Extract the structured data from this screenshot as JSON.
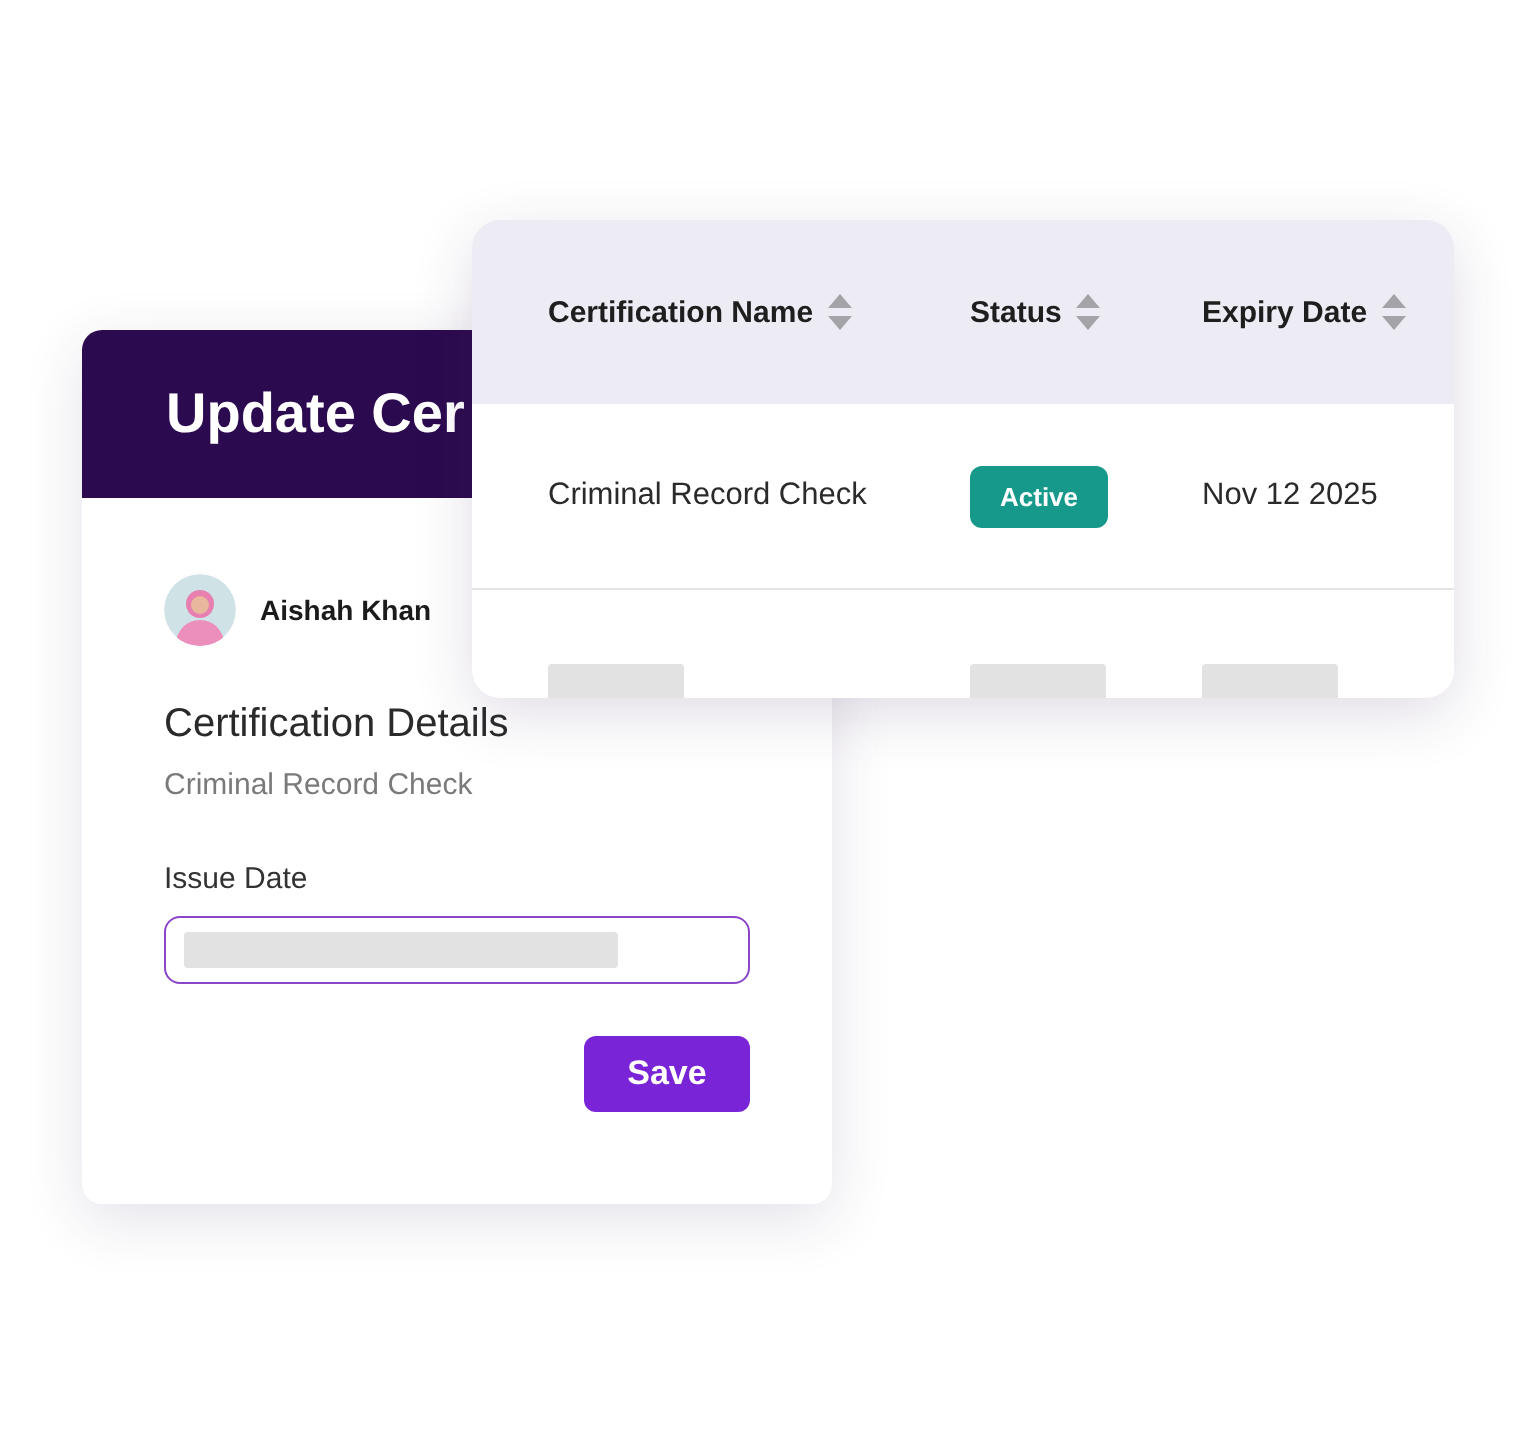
{
  "update_form": {
    "title": "Update Cer",
    "user": {
      "name": "Aishah Khan"
    },
    "section_title": "Certification Details",
    "certification": "Criminal Record Check",
    "field": {
      "label": "Issue Date"
    },
    "button": "Save"
  },
  "table": {
    "columns": [
      {
        "label": "Certification Name",
        "sortable": true
      },
      {
        "label": "Status",
        "sortable": true
      },
      {
        "label": "Expiry Date",
        "sortable": true
      }
    ],
    "rows": [
      {
        "name": "Criminal Record Check",
        "status": {
          "label": "Active",
          "color": "#16998a"
        },
        "expiry": "Nov 12 2025"
      }
    ]
  }
}
